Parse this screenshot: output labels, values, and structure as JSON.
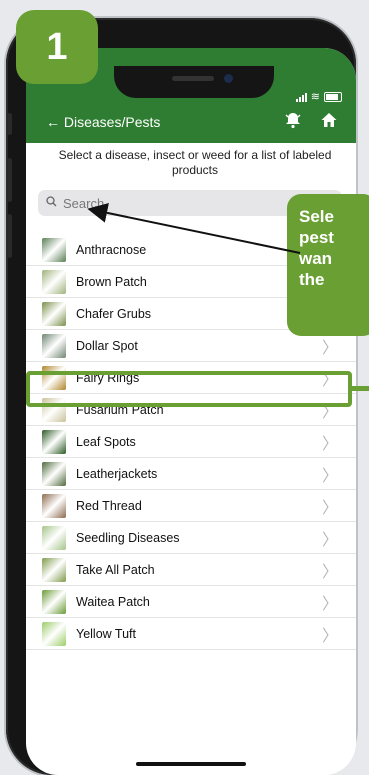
{
  "step_badge": "1",
  "header": {
    "back_label": "← Diseases/Pests",
    "bell_icon": "bell-icon",
    "home_icon": "home-icon",
    "color": "#2e7d32"
  },
  "subtitle": "Select a disease, insect or weed for a list of labeled products",
  "search": {
    "placeholder": "Search",
    "value": ""
  },
  "items": [
    {
      "label": "Anthracnose",
      "color": "#5a7f55"
    },
    {
      "label": "Brown Patch",
      "color": "#9fb27a"
    },
    {
      "label": "Chafer Grubs",
      "color": "#7a8f4a"
    },
    {
      "label": "Dollar Spot",
      "color": "#6f8570"
    },
    {
      "label": "Fairy Rings",
      "color": "#b0852a"
    },
    {
      "label": "Fusarium Patch",
      "color": "#c9c29a"
    },
    {
      "label": "Leaf Spots",
      "color": "#2c5a24"
    },
    {
      "label": "Leatherjackets",
      "color": "#4f6a3c"
    },
    {
      "label": "Red Thread",
      "color": "#8c6a4c"
    },
    {
      "label": "Seedling Diseases",
      "color": "#a5c48a"
    },
    {
      "label": "Take All Patch",
      "color": "#7f9a4c"
    },
    {
      "label": "Waitea Patch",
      "color": "#6a9a36"
    },
    {
      "label": "Yellow Tuft",
      "color": "#9ccc6a"
    }
  ],
  "callout": {
    "lines": [
      "Sele",
      "pest",
      "wan",
      "the"
    ],
    "color": "#6aa033"
  },
  "highlighted_item": "Fusarium Patch"
}
